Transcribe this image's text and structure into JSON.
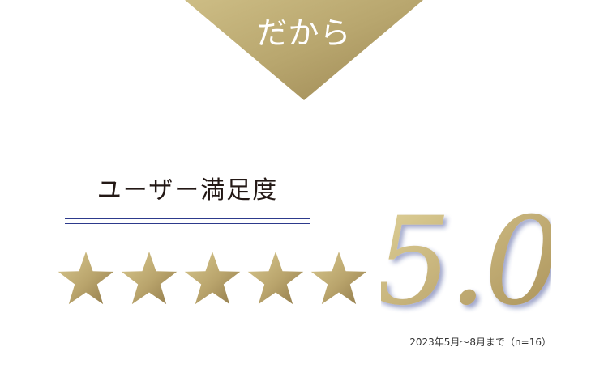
{
  "banner": {
    "text": "だから"
  },
  "satisfaction": {
    "title": "ユーザー満足度",
    "rating": 5.0,
    "rating_max": 5,
    "score_text": "5.0",
    "note": "2023年5月〜8月まで（n=16）"
  },
  "colors": {
    "gold_light": "#d8c98e",
    "gold_dark": "#9a8450",
    "rule": "#2d3a8c",
    "title_text": "#231815"
  }
}
